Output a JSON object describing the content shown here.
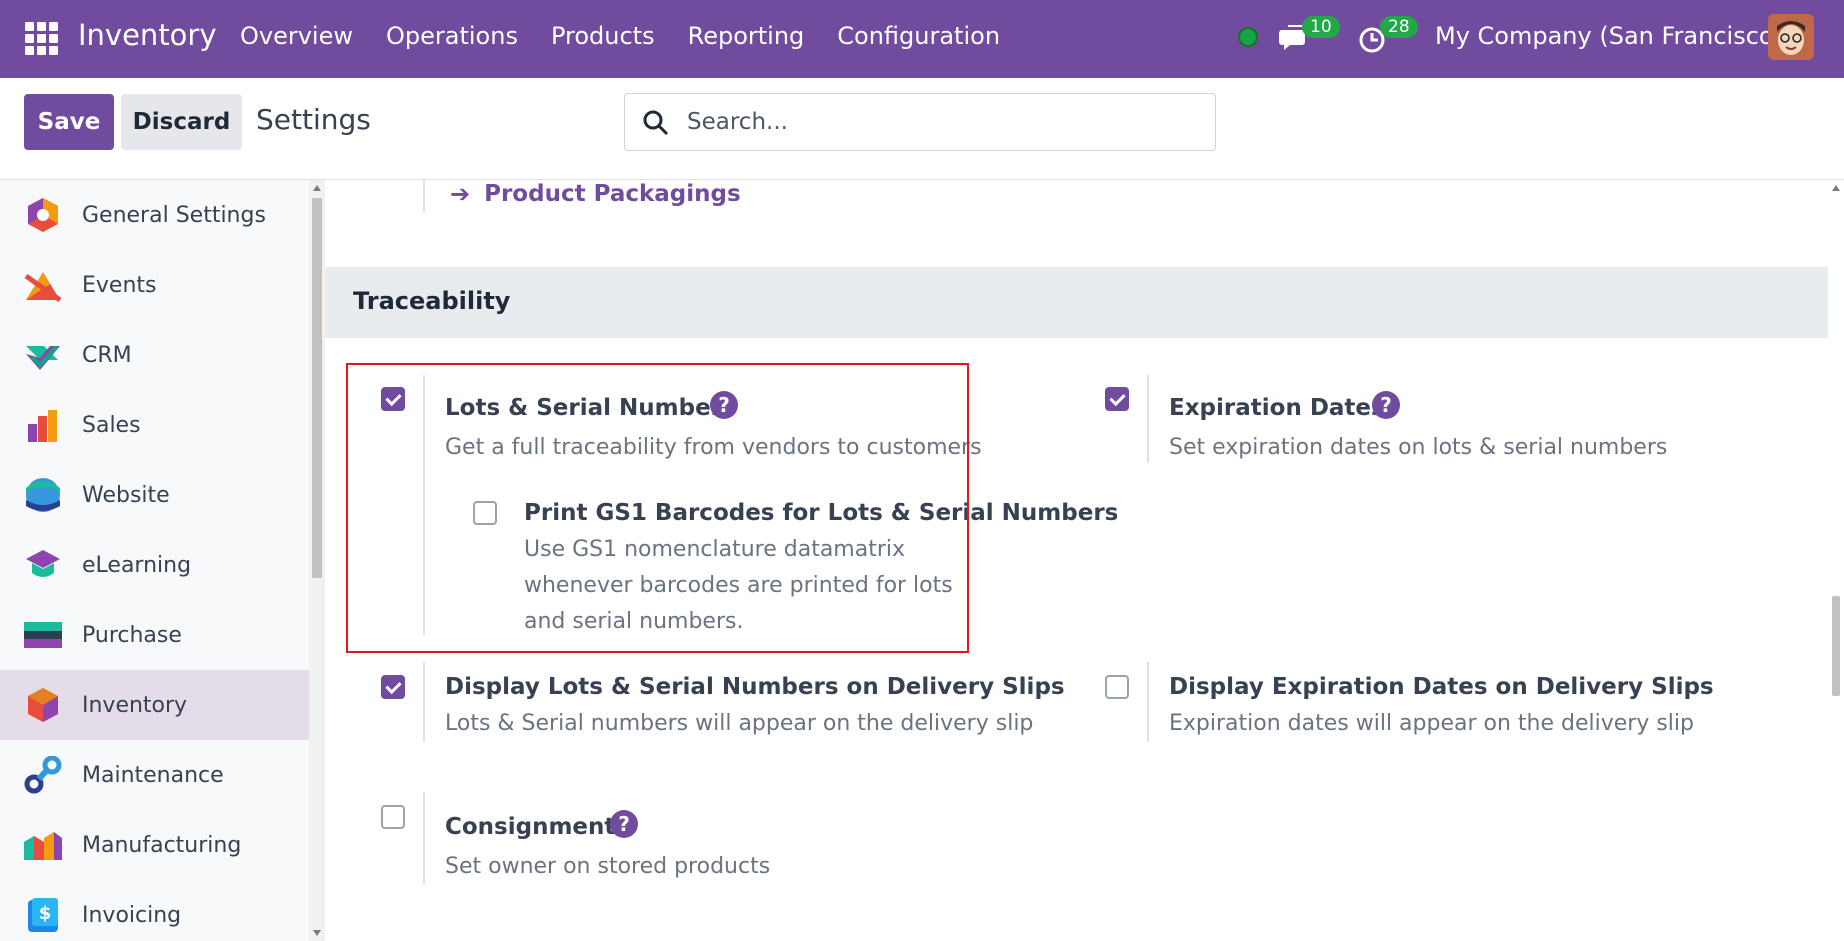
{
  "navbar": {
    "app_name": "Inventory",
    "menu": [
      "Overview",
      "Operations",
      "Products",
      "Reporting",
      "Configuration"
    ],
    "messages_count": "10",
    "activities_count": "28",
    "company": "My Company (San Francisco)"
  },
  "control": {
    "save_label": "Save",
    "discard_label": "Discard",
    "breadcrumb": "Settings",
    "search_placeholder": "Search..."
  },
  "sidebar": {
    "items": [
      {
        "label": "General Settings",
        "icon": "general-settings-icon"
      },
      {
        "label": "Events",
        "icon": "events-icon"
      },
      {
        "label": "CRM",
        "icon": "crm-icon"
      },
      {
        "label": "Sales",
        "icon": "sales-icon"
      },
      {
        "label": "Website",
        "icon": "website-icon"
      },
      {
        "label": "eLearning",
        "icon": "elearning-icon"
      },
      {
        "label": "Purchase",
        "icon": "purchase-icon"
      },
      {
        "label": "Inventory",
        "icon": "inventory-icon",
        "active": true
      },
      {
        "label": "Maintenance",
        "icon": "maintenance-icon"
      },
      {
        "label": "Manufacturing",
        "icon": "manufacturing-icon"
      },
      {
        "label": "Invoicing",
        "icon": "invoicing-icon"
      }
    ]
  },
  "main": {
    "product_packagings_link": "Product Packagings",
    "section_title": "Traceability",
    "settings": {
      "lots": {
        "title": "Lots & Serial Numbers",
        "desc": "Get a full traceability from vendors to customers",
        "checked": true
      },
      "gs1": {
        "title": "Print GS1 Barcodes for Lots & Serial Numbers",
        "desc": "Use GS1 nomenclature datamatrix whenever barcodes are printed for lots and serial numbers.",
        "checked": false
      },
      "expiration": {
        "title": "Expiration Dates",
        "desc": "Set expiration dates on lots & serial numbers",
        "checked": true
      },
      "display_lots": {
        "title": "Display Lots & Serial Numbers on Delivery Slips",
        "desc": "Lots & Serial numbers will appear on the delivery slip",
        "checked": true
      },
      "display_expiration": {
        "title": "Display Expiration Dates on Delivery Slips",
        "desc": "Expiration dates will appear on the delivery slip",
        "checked": false
      },
      "consignment": {
        "title": "Consignment",
        "desc": "Set owner on stored products",
        "checked": false
      }
    },
    "help_glyph": "?"
  },
  "colors": {
    "brand": "#714B9E",
    "badge": "#22a846",
    "highlight": "#e0171e"
  }
}
